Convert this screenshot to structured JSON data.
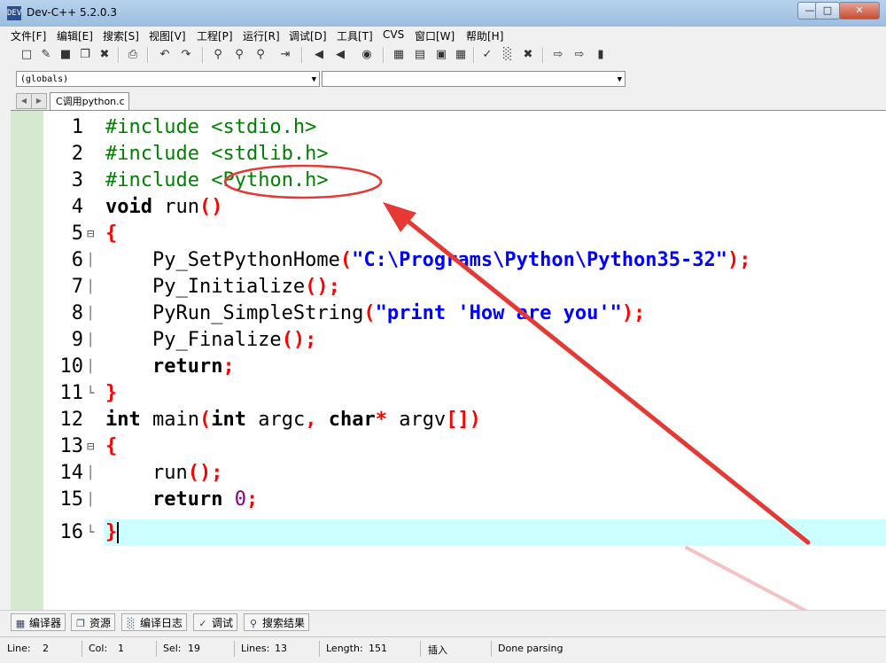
{
  "window": {
    "title": "Dev-C++ 5.2.0.3",
    "app_icon_text": "DEV"
  },
  "menu": [
    "文件[F]",
    "编辑[E]",
    "搜索[S]",
    "视图[V]",
    "工程[P]",
    "运行[R]",
    "调试[D]",
    "工具[T]",
    "CVS",
    "窗口[W]",
    "帮助[H]"
  ],
  "combos": {
    "scope": "(globals)",
    "member": ""
  },
  "tab": {
    "label": "C调用python.c"
  },
  "code": {
    "line_numbers": [
      "1",
      "2",
      "3",
      "4",
      "5",
      "6",
      "7",
      "8",
      "9",
      "10",
      "11",
      "12",
      "13",
      "14",
      "15",
      "16"
    ],
    "l1": "#include <stdio.h>",
    "l2": "#include <stdlib.h>",
    "l3_a": "#include ",
    "l3_b": "<Python.h>",
    "l4_kw": "void",
    "l4_name": " run",
    "l4_sym": "()",
    "l5": "{",
    "l6_fn": "    Py_SetPythonHome",
    "l6_o": "(",
    "l6_str": "\"C:\\Programs\\Python\\Python35-32\"",
    "l6_c": ");",
    "l7_fn": "    Py_Initialize",
    "l7_sym": "();",
    "l8_fn": "    PyRun_SimpleString",
    "l8_o": "(",
    "l8_str": "\"print 'How are you'\"",
    "l8_c": ");",
    "l9_fn": "    Py_Finalize",
    "l9_sym": "();",
    "l10_indent": "    ",
    "l10_kw": "return",
    "l10_sym": ";",
    "l11": "}",
    "l12_kw1": "int",
    "l12_a": " main",
    "l12_o": "(",
    "l12_kw2": "int",
    "l12_b": " argc",
    "l12_comma": ",",
    "l12_sp": " ",
    "l12_kw3": "char",
    "l12_star": "*",
    "l12_c": " argv",
    "l12_close": "[])",
    "l13": "{",
    "l14_fn": "    run",
    "l14_sym": "();",
    "l15_indent": "    ",
    "l15_kw": "return",
    "l15_sp": " ",
    "l15_num": "0",
    "l15_sym": ";",
    "l16": "}"
  },
  "bottom_tabs": [
    "编译器",
    "资源",
    "编译日志",
    "调试",
    "搜索结果"
  ],
  "status": {
    "line_label": "Line:",
    "line": "2",
    "col_label": "Col:",
    "col": "1",
    "sel_label": "Sel:",
    "sel": "19",
    "lines_label": "Lines:",
    "lines": "13",
    "length_label": "Length:",
    "length": "151",
    "mode": "插入",
    "message": "Done parsing"
  },
  "colors": {
    "preprocessor": "#008000",
    "symbol": "#ff0000",
    "string": "#0000ff",
    "number": "#800080",
    "current_line": "#ccffff",
    "annotation": "#e53935"
  }
}
